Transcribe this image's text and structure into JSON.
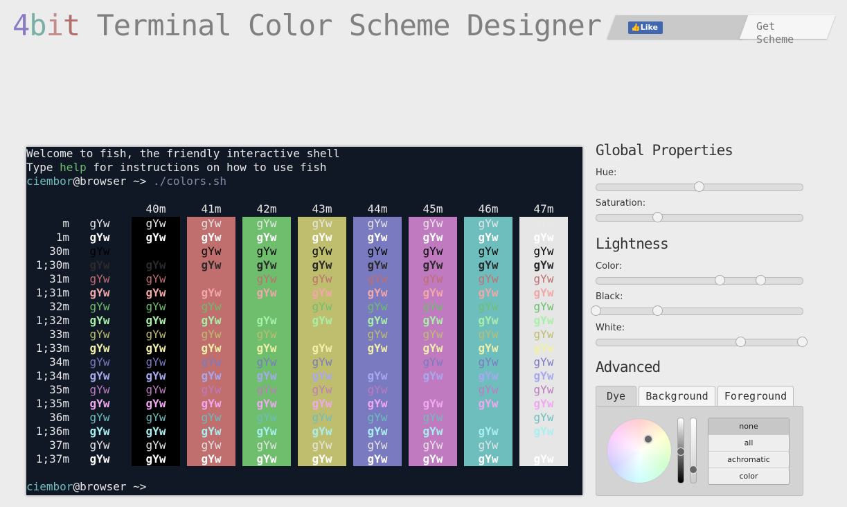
{
  "header": {
    "title_4": "4",
    "title_b": "b",
    "title_i": "i",
    "title_t": "t",
    "title_rest": " Terminal Color Scheme Designer",
    "like_label": "Like",
    "get_scheme_label": "Get Scheme"
  },
  "terminal": {
    "welcome": "Welcome to fish, the friendly interactive shell",
    "type_prefix": "Type ",
    "help_word": "help",
    "type_suffix": " for instructions on how to use fish",
    "prompt_user": "ciembor",
    "prompt_host": "@browser ~> ",
    "command": "./colors.sh",
    "sample_text": "gYw",
    "bg_headers": [
      "40m",
      "41m",
      "42m",
      "43m",
      "44m",
      "45m",
      "46m",
      "47m"
    ],
    "row_labels": [
      "m",
      "1m",
      "30m",
      "1;30m",
      "31m",
      "1;31m",
      "32m",
      "1;32m",
      "33m",
      "1;33m",
      "34m",
      "1;34m",
      "35m",
      "1;35m",
      "36m",
      "1;36m",
      "37m",
      "1;37m"
    ]
  },
  "global_properties": {
    "heading": "Global Properties",
    "hue_label": "Hue:",
    "hue_value": 0.5,
    "saturation_label": "Saturation:",
    "saturation_value": 0.3
  },
  "lightness": {
    "heading": "Lightness",
    "color_label": "Color:",
    "color_range": [
      0.6,
      0.8
    ],
    "black_label": "Black:",
    "black_range": [
      0.0,
      0.3
    ],
    "white_label": "White:",
    "white_range": [
      0.7,
      1.0
    ]
  },
  "advanced": {
    "heading": "Advanced",
    "tabs": [
      "Dye",
      "Background",
      "Foreground"
    ],
    "active_tab": "Dye",
    "dye_options": [
      "none",
      "all",
      "achromatic",
      "color"
    ],
    "selected_option": "none"
  },
  "colors": {
    "term_bg": "#101826",
    "palette_normal": [
      "#000000",
      "#c06e6e",
      "#6ebe6e",
      "#bebe6e",
      "#7a7ac0",
      "#c07ac0",
      "#6ebebe",
      "#e6e6e6"
    ],
    "palette_bold": [
      "#2a2a2a",
      "#f0a8a8",
      "#a8f0a8",
      "#f0f0a8",
      "#a8a8f0",
      "#f0a8f0",
      "#a8f0f0",
      "#ffffff"
    ],
    "default_fg": "#e8e8e8",
    "prompt_user_color": "#6ebebe",
    "command_color": "#8a8aa8",
    "help_color": "#6ebe6e"
  }
}
